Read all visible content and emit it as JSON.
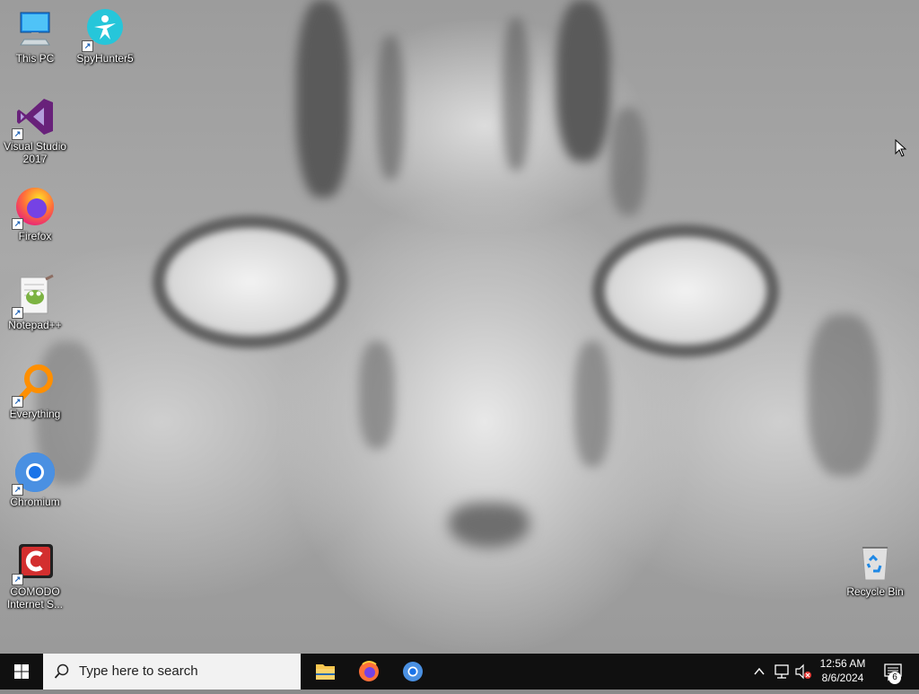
{
  "desktop": {
    "icons": [
      {
        "label": "This PC"
      },
      {
        "label": "SpyHunter5"
      },
      {
        "label": "Visual Studio\n2017"
      },
      {
        "label": "Firefox"
      },
      {
        "label": "Notepad++"
      },
      {
        "label": "Everything"
      },
      {
        "label": "Chromium"
      },
      {
        "label": "COMODO\nInternet S..."
      },
      {
        "label": "Recycle Bin"
      }
    ]
  },
  "taskbar": {
    "search_placeholder": "Type here to search",
    "pinned": [
      {
        "name": "File Explorer"
      },
      {
        "name": "Firefox"
      },
      {
        "name": "Chromium"
      }
    ],
    "clock": {
      "time": "12:56 AM",
      "date": "8/6/2024"
    },
    "notification_count": "6"
  },
  "colors": {
    "taskbar_bg": "#101010",
    "search_bg": "#f2f2f2",
    "accent_blue": "#1a73e8"
  }
}
